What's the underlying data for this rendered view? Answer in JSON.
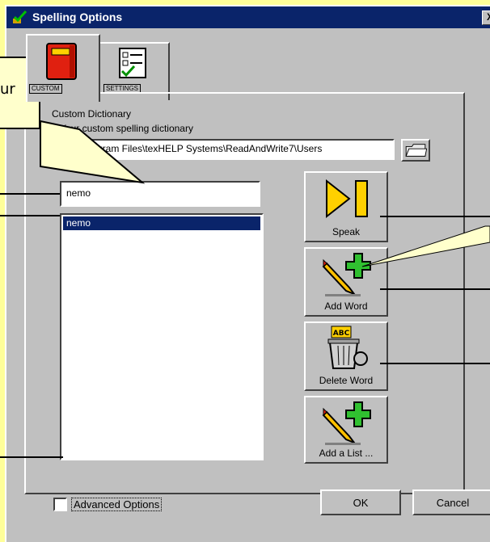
{
  "window": {
    "title": "Spelling Options",
    "close_glyph": "X"
  },
  "tabs": [
    {
      "label": "CUSTOM",
      "icon": "book-icon",
      "selected": true
    },
    {
      "label": "SETTINGS",
      "icon": "checklist-icon",
      "selected": false
    }
  ],
  "custom_dictionary": {
    "group_label": "Custom Dictionary",
    "path_label": "Your custom spelling dictionary",
    "path_value": "C:\\Program Files\\texHELP Systems\\ReadAndWrite7\\Users"
  },
  "word_input": {
    "value": "nemo"
  },
  "word_list": {
    "items": [
      "nemo"
    ],
    "selected_index": 0
  },
  "buttons": {
    "speak": "Speak",
    "add_word": "Add Word",
    "delete_word": "Delete Word",
    "add_list": "Add a List ..."
  },
  "footer": {
    "advanced_options": "Advanced Options",
    "advanced_checked": false,
    "ok": "OK",
    "cancel": "Cancel"
  },
  "annotation": {
    "callout_fragment": "ur"
  },
  "colors": {
    "background": "#ffff99",
    "titlebar": "#0a246a",
    "selection": "#0a246a",
    "dialog": "#c0c0c0"
  }
}
